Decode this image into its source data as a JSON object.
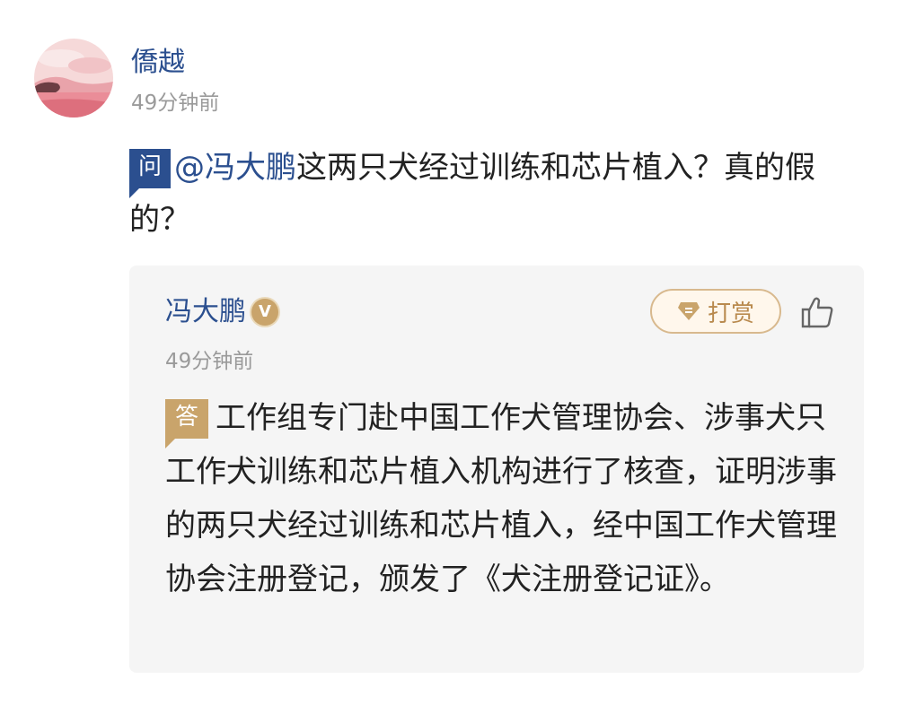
{
  "post": {
    "author": "僑越",
    "time": "49分钟前"
  },
  "question": {
    "badge": "问",
    "mention": "@冯大鹏",
    "text": "这两只犬经过训练和芯片植入？真的假的？"
  },
  "answer": {
    "author": "冯大鹏",
    "verified_badge": "V",
    "time": "49分钟前",
    "reward_label": "打赏",
    "badge": "答",
    "text": "工作组专门赴中国工作犬管理协会、涉事犬只工作犬训练和芯片植入机构进行了核查，证明涉事的两只犬经过训练和芯片植入，经中国工作犬管理协会注册登记，颁发了《犬注册登记证》。"
  },
  "icons": {
    "avatar": "landscape-avatar",
    "verified": "verified-v-icon",
    "reward": "gem-icon",
    "like": "thumbs-up-icon"
  },
  "colors": {
    "link_blue": "#2b4f8f",
    "gold": "#c9a46b",
    "muted": "#9a9a9a",
    "card_bg": "#f5f5f5"
  }
}
